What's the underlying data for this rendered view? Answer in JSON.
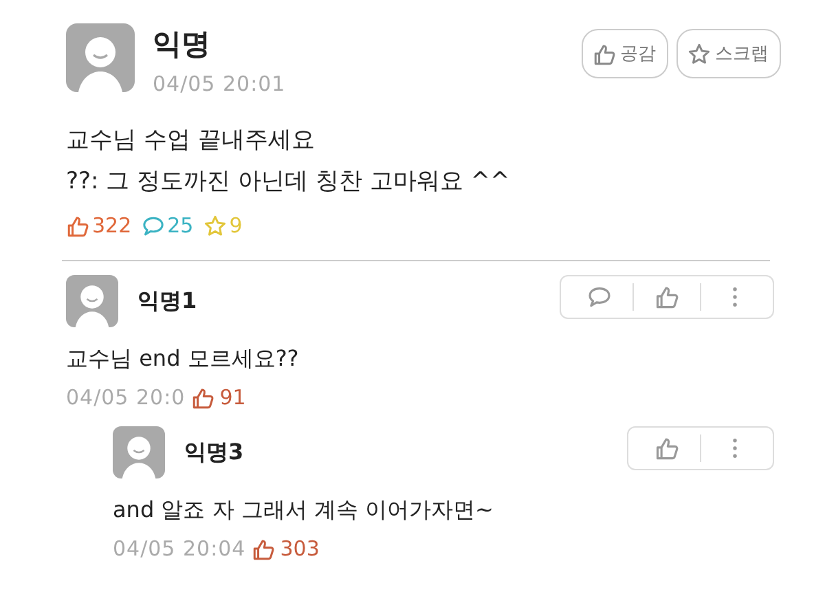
{
  "post": {
    "author": "익명",
    "time": "04/05 20:01",
    "buttons": [
      {
        "kind": "like",
        "label": "공감"
      },
      {
        "kind": "scrap",
        "label": "스크랩"
      }
    ],
    "body": [
      "교수님 수업 끝내주세요",
      "??: 그 정도까진 아닌데 칭찬 고마워요 ^^"
    ],
    "stats": [
      {
        "kind": "like",
        "count": "322",
        "color": "#e0683a"
      },
      {
        "kind": "comment",
        "count": "25",
        "color": "#3bb3c3"
      },
      {
        "kind": "scrap",
        "count": "9",
        "color": "#e2c63a"
      }
    ]
  },
  "comments": [
    {
      "author": "익명1",
      "text": "교수님 end 모르세요??",
      "time": "04/05 20:0",
      "likes": "91",
      "actions": [
        {
          "kind": "comment"
        },
        {
          "kind": "like"
        },
        {
          "kind": "more"
        }
      ],
      "children": [
        {
          "author": "익명3",
          "text": "and 알죠 자 그래서 계속 이어가자면~",
          "time": "04/05 20:04",
          "likes": "303",
          "actions": [
            {
              "kind": "like"
            },
            {
              "kind": "more"
            }
          ]
        }
      ]
    }
  ]
}
